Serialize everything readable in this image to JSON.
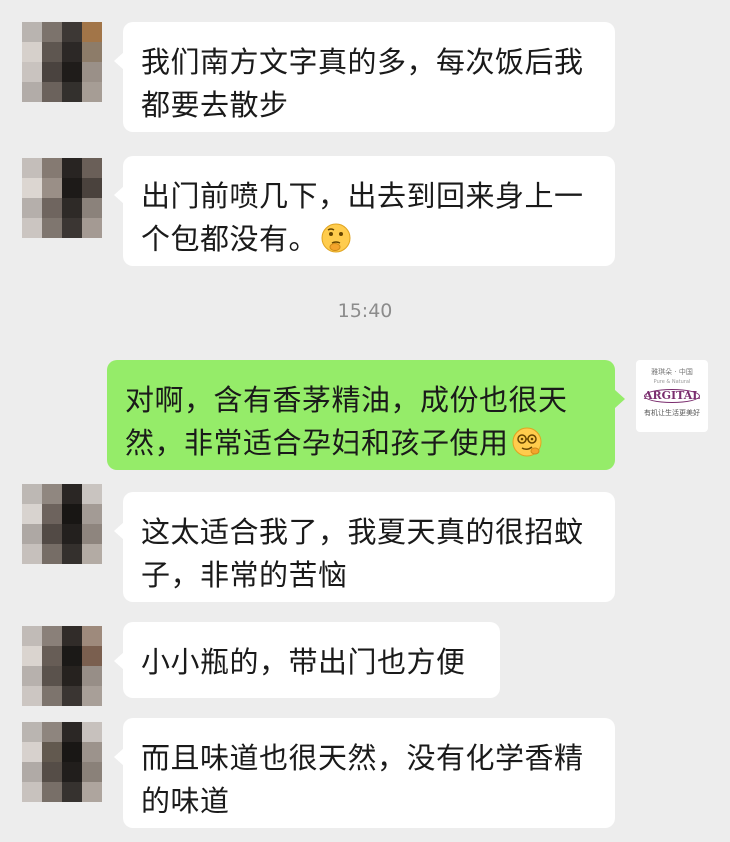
{
  "messages": [
    {
      "text": "我们南方文字真的多，每次饭后我都要去散步"
    },
    {
      "text": "出门前喷几下，出去到回来身上一个包都没有。"
    },
    {
      "text": "对啊，含有香茅精油，成份也很天然，非常适合孕妇和孩子使用"
    },
    {
      "text": "这太适合我了，我夏天真的很招蚊子，非常的苦恼"
    },
    {
      "text": "小小瓶的，带出门也方便"
    },
    {
      "text": "而且味道也很天然，没有化学香精的味道"
    }
  ],
  "timestamp": "15:40",
  "brand_avatar": {
    "top_text": "雅琪朵 · 中国",
    "sub_text": "Pure & Natural",
    "logo_text": "ARGITAL",
    "bottom_text": "有机让生活更美好"
  },
  "colors": {
    "background": "#ededed",
    "incoming_bubble": "#ffffff",
    "outgoing_bubble": "#95ec69",
    "brand_purple": "#7a2d6e"
  },
  "icons": [
    "pixelated-avatar",
    "thinking-face-emoji",
    "nerd-face-emoji",
    "argital-logo"
  ]
}
